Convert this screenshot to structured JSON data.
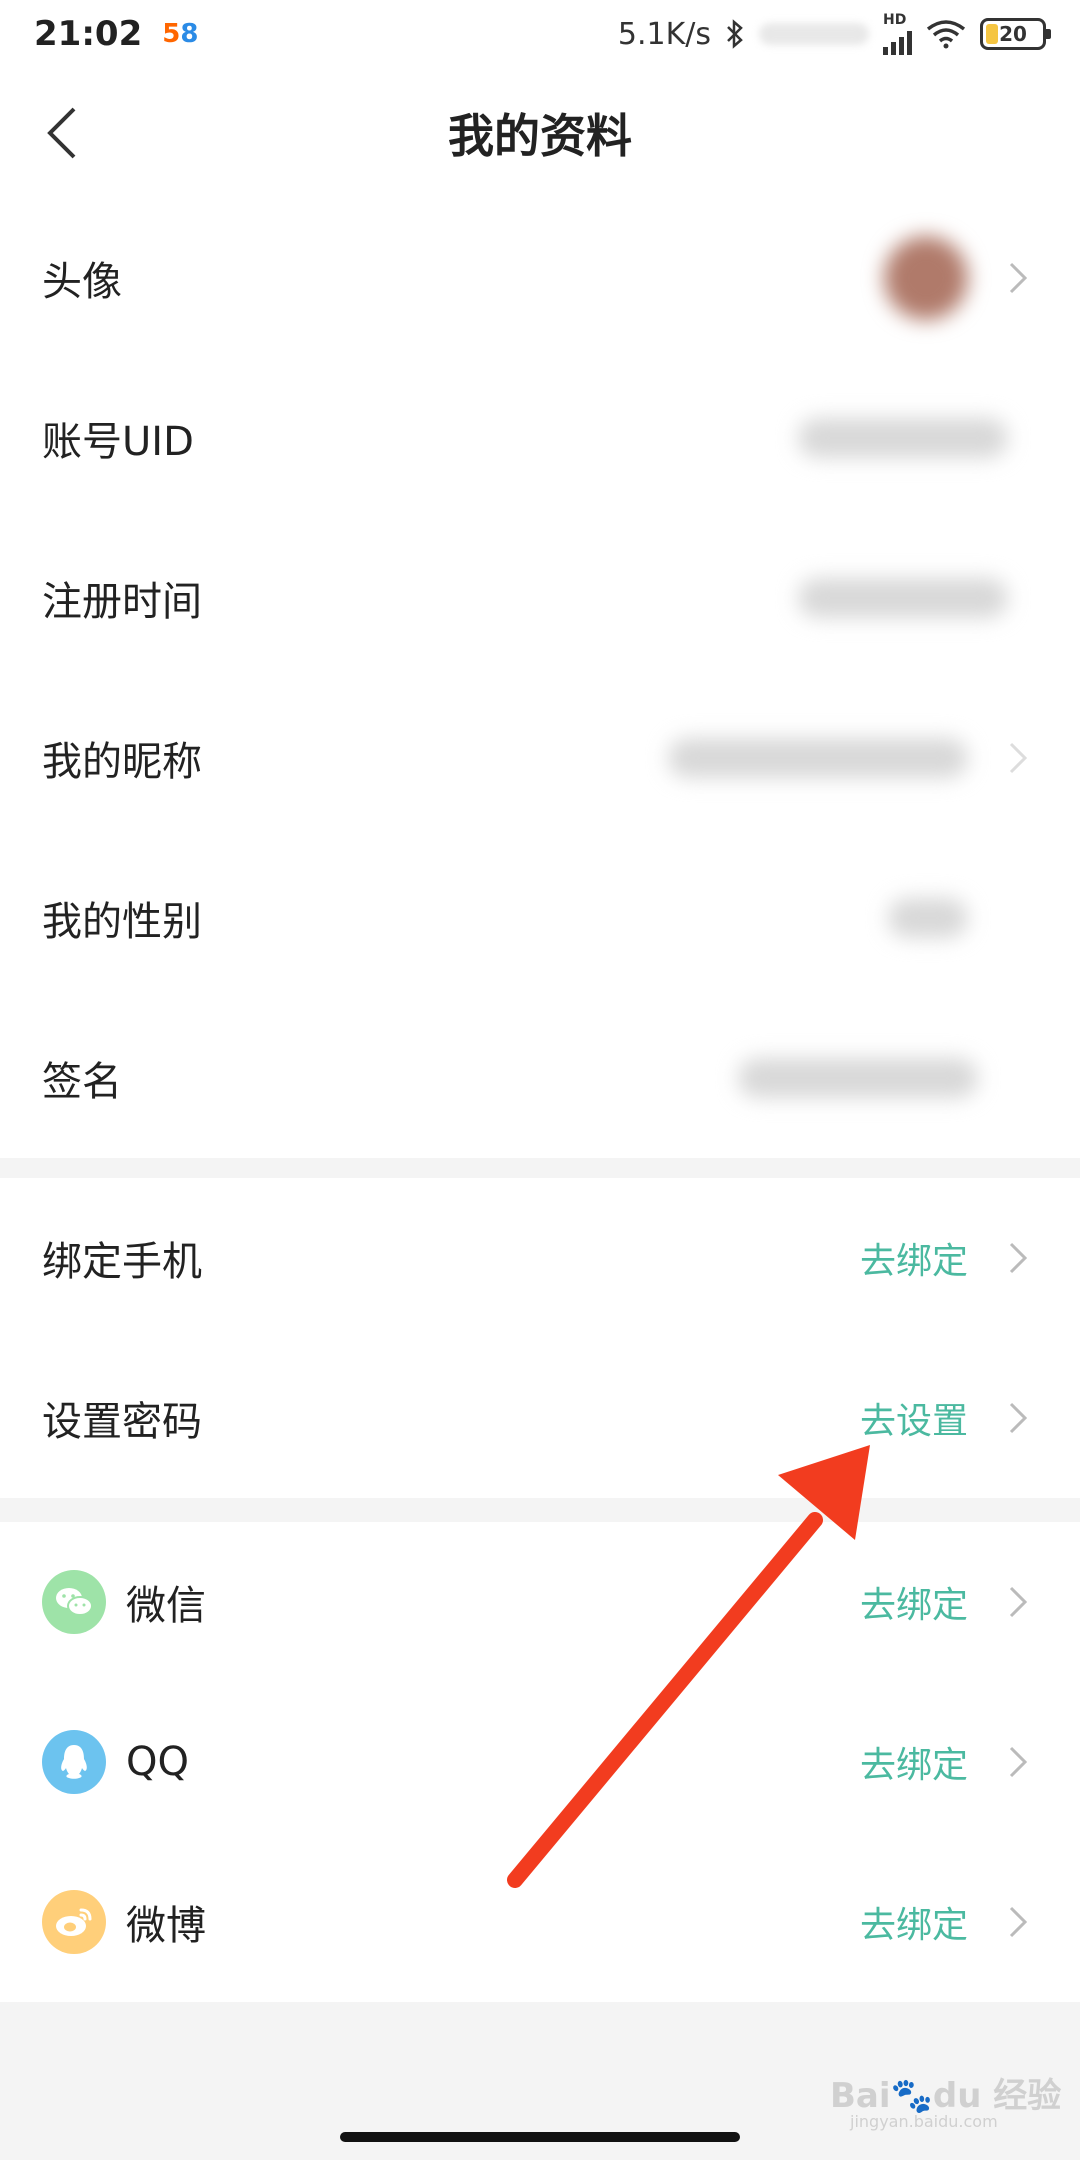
{
  "status_bar": {
    "time": "21:02",
    "app_badge": [
      "5",
      "8"
    ],
    "net_speed": "5.1K/s",
    "hd_label": "HD",
    "battery_level": "20",
    "battery_fraction": 0.2
  },
  "header": {
    "title": "我的资料"
  },
  "profile": {
    "avatar_label": "头像",
    "uid_label": "账号UID",
    "register_label": "注册时间",
    "nickname_label": "我的昵称",
    "gender_label": "我的性别",
    "signature_label": "签名"
  },
  "security": {
    "phone_label": "绑定手机",
    "phone_action": "去绑定",
    "password_label": "设置密码",
    "password_action": "去设置"
  },
  "social": {
    "wechat_label": "微信",
    "wechat_action": "去绑定",
    "qq_label": "QQ",
    "qq_action": "去绑定",
    "weibo_label": "微博",
    "weibo_action": "去绑定"
  },
  "watermark": {
    "brand": "Bai",
    "brand_suffix": "经验",
    "site": "jingyan.baidu.com"
  },
  "colors": {
    "accent": "#4bb9a0",
    "wechat": "#9ee3a8",
    "qq": "#6cc3ef",
    "weibo": "#ffcf7a",
    "arrow": "#f23c1f"
  }
}
